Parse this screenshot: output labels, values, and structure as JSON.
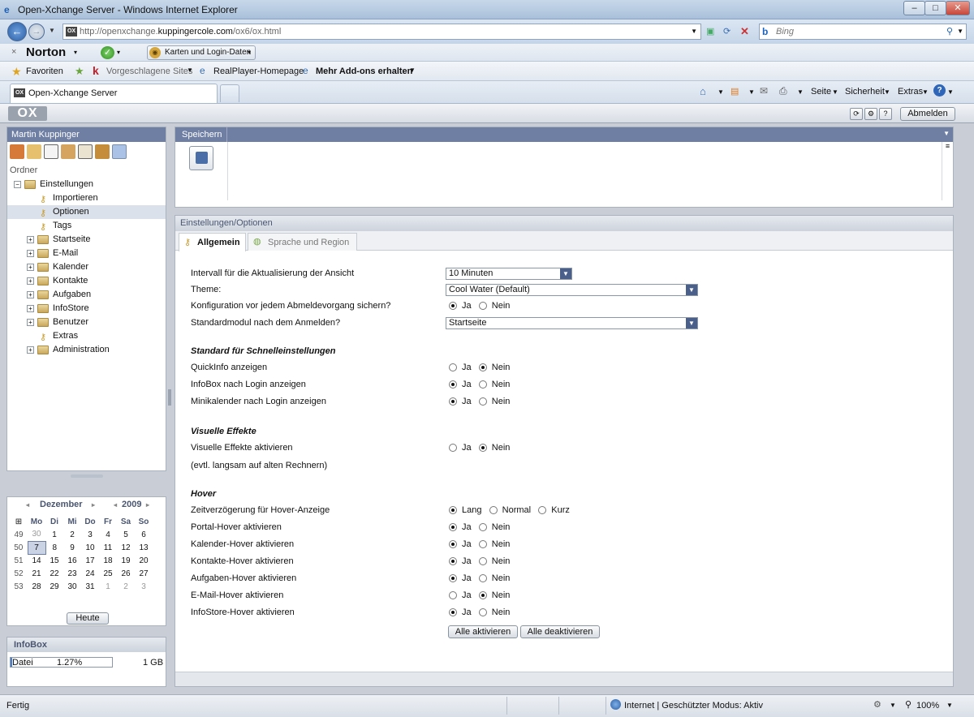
{
  "browser": {
    "window_title": "Open-Xchange Server - Windows Internet Explorer",
    "url_prefix": "http://openxchange.",
    "url_domain": "kuppingercole.com",
    "url_path": "/ox6/ox.html",
    "search_placeholder": "Bing",
    "norton_label": "Norton",
    "norton_close": "×",
    "karten_label": "Karten und Login-Daten",
    "favorites_label": "Favoriten",
    "suggested_sites": "Vorgeschlagene Sites",
    "realplayer": "RealPlayer-Homepage",
    "addons": "Mehr Add-ons erhalten",
    "tab_title": "Open-Xchange Server",
    "menu_seite": "Seite",
    "menu_sicherheit": "Sicherheit",
    "menu_extras": "Extras",
    "status_left": "Fertig",
    "status_zone": "Internet | Geschützter Modus: Aktiv",
    "zoom": "100%"
  },
  "app": {
    "logo": "OX",
    "logout": "Abmelden",
    "user": "Martin Kuppinger",
    "folder_label": "Ordner",
    "tree": [
      {
        "label": "Einstellungen",
        "type": "folder-open",
        "level": 0
      },
      {
        "label": "Importieren",
        "type": "key",
        "level": 1
      },
      {
        "label": "Optionen",
        "type": "key",
        "level": 1,
        "selected": true
      },
      {
        "label": "Tags",
        "type": "key",
        "level": 1
      },
      {
        "label": "Startseite",
        "type": "folder",
        "level": 1
      },
      {
        "label": "E-Mail",
        "type": "folder",
        "level": 1
      },
      {
        "label": "Kalender",
        "type": "folder",
        "level": 1
      },
      {
        "label": "Kontakte",
        "type": "folder",
        "level": 1
      },
      {
        "label": "Aufgaben",
        "type": "folder",
        "level": 1
      },
      {
        "label": "InfoStore",
        "type": "folder",
        "level": 1
      },
      {
        "label": "Benutzer",
        "type": "folder",
        "level": 1
      },
      {
        "label": "Extras",
        "type": "key",
        "level": 1
      },
      {
        "label": "Administration",
        "type": "folder",
        "level": 1
      }
    ],
    "calendar": {
      "month": "Dezember",
      "year": "2009",
      "weekdays": [
        "Mo",
        "Di",
        "Mi",
        "Do",
        "Fr",
        "Sa",
        "So"
      ],
      "weeks": [
        {
          "wk": "49",
          "days": [
            "30",
            "1",
            "2",
            "3",
            "4",
            "5",
            "6"
          ]
        },
        {
          "wk": "50",
          "days": [
            "7",
            "8",
            "9",
            "10",
            "11",
            "12",
            "13"
          ]
        },
        {
          "wk": "51",
          "days": [
            "14",
            "15",
            "16",
            "17",
            "18",
            "19",
            "20"
          ]
        },
        {
          "wk": "52",
          "days": [
            "21",
            "22",
            "23",
            "24",
            "25",
            "26",
            "27"
          ]
        },
        {
          "wk": "53",
          "days": [
            "28",
            "29",
            "30",
            "31",
            "1",
            "2",
            "3"
          ]
        }
      ],
      "today_label": "Heute"
    },
    "infobox": {
      "title": "InfoBox",
      "label": "Datei",
      "percent": "1.27%",
      "total": "1 GB",
      "fill": 0.0127
    },
    "toolbar": {
      "title": "Speichern"
    },
    "settings": {
      "title": "Einstellungen/Optionen",
      "tab_general": "Allgemein",
      "tab_language": "Sprache und Region",
      "refresh_label": "Intervall für die Aktualisierung der Ansicht",
      "refresh_value": "10 Minuten",
      "theme_label": "Theme:",
      "theme_value": "Cool Water (Default)",
      "save_config_label": "Konfiguration vor jedem Abmeldevorgang sichern?",
      "default_module_label": "Standardmodul nach dem Anmelden?",
      "default_module_value": "Startseite",
      "yes": "Ja",
      "no": "Nein",
      "section_quick": "Standard für Schnelleinstellungen",
      "quickinfo": "QuickInfo anzeigen",
      "infobox_login": "InfoBox nach Login anzeigen",
      "minical_login": "Minikalender nach Login anzeigen",
      "section_visual": "Visuelle Effekte",
      "visual_label": "Visuelle Effekte aktivieren",
      "visual_note": "(evtl. langsam auf alten Rechnern)",
      "section_hover": "Hover",
      "hover_delay": "Zeitverzögerung für Hover-Anzeige",
      "lang": "Lang",
      "normal": "Normal",
      "kurz": "Kurz",
      "portal_hover": "Portal-Hover aktivieren",
      "calendar_hover": "Kalender-Hover aktivieren",
      "contacts_hover": "Kontakte-Hover aktivieren",
      "tasks_hover": "Aufgaben-Hover aktivieren",
      "mail_hover": "E-Mail-Hover aktivieren",
      "infostore_hover": "InfoStore-Hover aktivieren",
      "all_on": "Alle aktivieren",
      "all_off": "Alle deaktivieren"
    }
  }
}
